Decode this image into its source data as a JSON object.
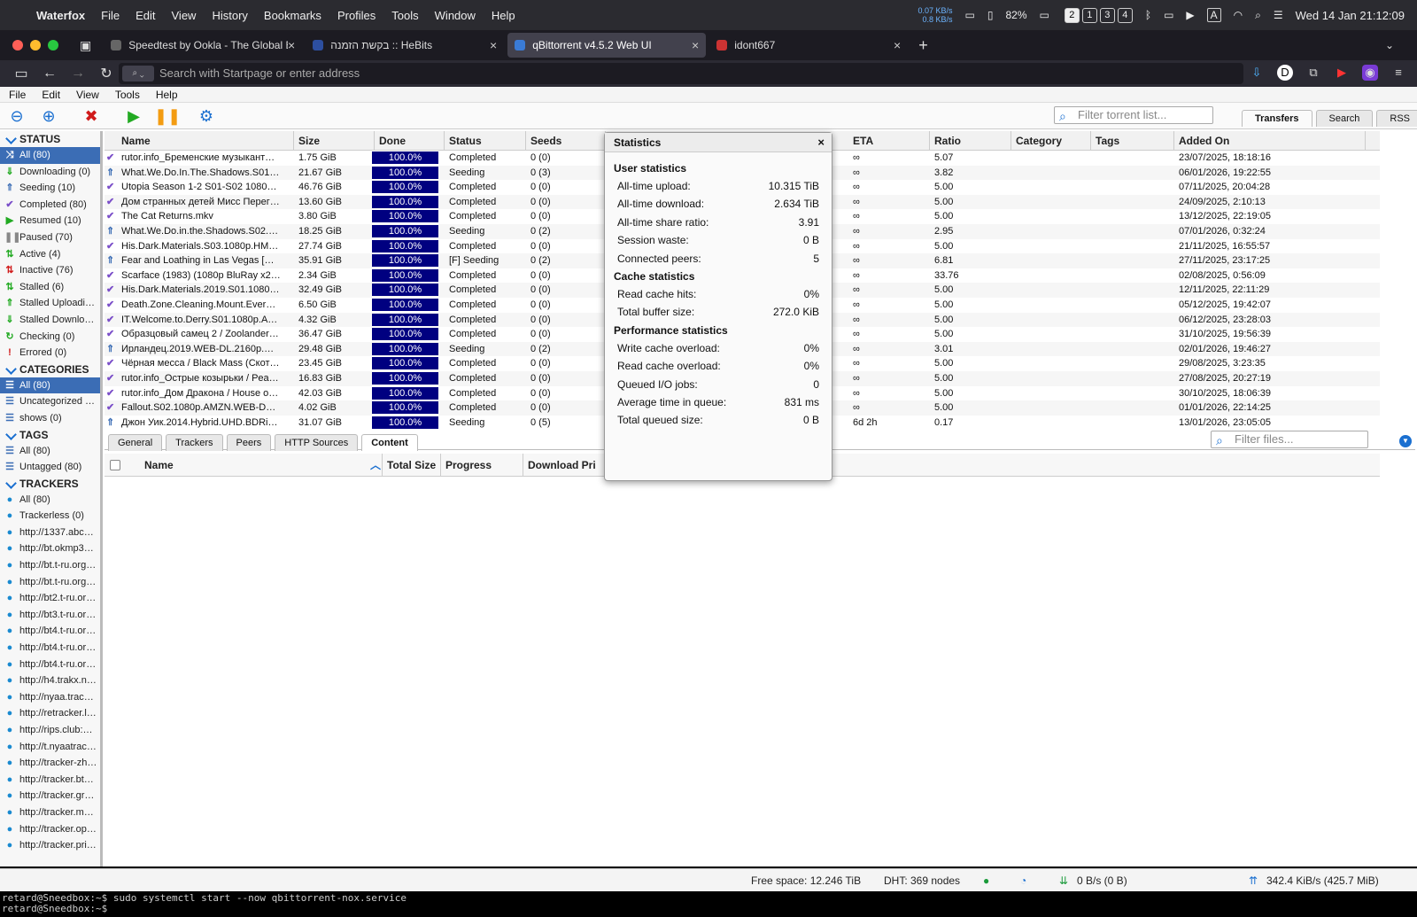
{
  "mac_menu": {
    "app": "Waterfox",
    "items": [
      "File",
      "Edit",
      "View",
      "History",
      "Bookmarks",
      "Profiles",
      "Tools",
      "Window",
      "Help"
    ],
    "speed_up": "0.07 KB/s",
    "speed_down": "0.8 KB/s",
    "battery": "82%",
    "spaces": [
      "2",
      "1",
      "3",
      "4"
    ],
    "input": "A",
    "clock": "Wed 14 Jan  21:12:09"
  },
  "tabs": [
    {
      "title": "Speedtest by Ookla - The Global B",
      "active": false
    },
    {
      "title": "בקשת הזמנה :: HeBits",
      "active": false
    },
    {
      "title": "qBittorrent v4.5.2 Web UI",
      "active": true
    },
    {
      "title": "idont667",
      "active": false
    }
  ],
  "url_placeholder": "Search with Startpage or enter address",
  "app_menu": [
    "File",
    "Edit",
    "View",
    "Tools",
    "Help"
  ],
  "toolbar": {
    "filter_placeholder": "Filter torrent list...",
    "right_tabs": [
      "Transfers",
      "Search",
      "RSS"
    ]
  },
  "sidebar": {
    "status_header": "STATUS",
    "status": [
      "All (80)",
      "Downloading (0)",
      "Seeding (10)",
      "Completed (80)",
      "Resumed (10)",
      "Paused (70)",
      "Active (4)",
      "Inactive (76)",
      "Stalled (6)",
      "Stalled Uploadi…",
      "Stalled Downlo…",
      "Checking (0)",
      "Errored (0)"
    ],
    "categories_header": "CATEGORIES",
    "categories": [
      "All (80)",
      "Uncategorized …",
      "shows (0)"
    ],
    "tags_header": "TAGS",
    "tags": [
      "All (80)",
      "Untagged (80)"
    ],
    "trackers_header": "TRACKERS",
    "trackers": [
      "All (80)",
      "Trackerless (0)",
      "http://1337.abc…",
      "http://bt.okmp3…",
      "http://bt.t-ru.org…",
      "http://bt.t-ru.org…",
      "http://bt2.t-ru.or…",
      "http://bt3.t-ru.or…",
      "http://bt4.t-ru.or…",
      "http://bt4.t-ru.or…",
      "http://bt4.t-ru.or…",
      "http://h4.trakx.n…",
      "http://nyaa.trac…",
      "http://retracker.l…",
      "http://rips.club:…",
      "http://t.nyaatrac…",
      "http://tracker-zh…",
      "http://tracker.bt…",
      "http://tracker.gr…",
      "http://tracker.m…",
      "http://tracker.op…",
      "http://tracker.pri…"
    ]
  },
  "columns": [
    "Name",
    "Size",
    "Done",
    "Status",
    "Seeds",
    "ETA",
    "Ratio",
    "Category",
    "Tags",
    "Added On"
  ],
  "torrents": [
    {
      "name": "rutor.info_Бременские музыкант…",
      "size": "1.75 GiB",
      "done": "100.0%",
      "status": "Completed",
      "seeds": "0 (0)",
      "eta": "∞",
      "ratio": "5.07",
      "added": "23/07/2025, 18:18:16",
      "icon": "check"
    },
    {
      "name": "What.We.Do.In.The.Shadows.S01…",
      "size": "21.67 GiB",
      "done": "100.0%",
      "status": "Seeding",
      "seeds": "0 (3)",
      "eta": "∞",
      "ratio": "3.82",
      "added": "06/01/2026, 19:22:55",
      "icon": "up"
    },
    {
      "name": "Utopia Season 1-2 S01-S02 1080…",
      "size": "46.76 GiB",
      "done": "100.0%",
      "status": "Completed",
      "seeds": "0 (0)",
      "eta": "∞",
      "ratio": "5.00",
      "added": "07/11/2025, 20:04:28",
      "icon": "check"
    },
    {
      "name": "Дом странных детей Мисс Перег…",
      "size": "13.60 GiB",
      "done": "100.0%",
      "status": "Completed",
      "seeds": "0 (0)",
      "eta": "∞",
      "ratio": "5.00",
      "added": "24/09/2025, 2:10:13",
      "icon": "check"
    },
    {
      "name": "The Cat Returns.mkv",
      "size": "3.80 GiB",
      "done": "100.0%",
      "status": "Completed",
      "seeds": "0 (0)",
      "eta": "∞",
      "ratio": "5.00",
      "added": "13/12/2025, 22:19:05",
      "icon": "check"
    },
    {
      "name": "What.We.Do.in.the.Shadows.S02.…",
      "size": "18.25 GiB",
      "done": "100.0%",
      "status": "Seeding",
      "seeds": "0 (2)",
      "eta": "∞",
      "ratio": "2.95",
      "added": "07/01/2026, 0:32:24",
      "icon": "up"
    },
    {
      "name": "His.Dark.Materials.S03.1080p.HM…",
      "size": "27.74 GiB",
      "done": "100.0%",
      "status": "Completed",
      "seeds": "0 (0)",
      "eta": "∞",
      "ratio": "5.00",
      "added": "21/11/2025, 16:55:57",
      "icon": "check"
    },
    {
      "name": "Fear and Loathing in Las Vegas […",
      "size": "35.91 GiB",
      "done": "100.0%",
      "status": "[F] Seeding",
      "seeds": "0 (2)",
      "eta": "∞",
      "ratio": "6.81",
      "added": "27/11/2025, 23:17:25",
      "icon": "up"
    },
    {
      "name": "Scarface (1983) (1080p BluRay x2…",
      "size": "2.34 GiB",
      "done": "100.0%",
      "status": "Completed",
      "seeds": "0 (0)",
      "eta": "∞",
      "ratio": "33.76",
      "added": "02/08/2025, 0:56:09",
      "icon": "check"
    },
    {
      "name": "His.Dark.Materials.2019.S01.1080…",
      "size": "32.49 GiB",
      "done": "100.0%",
      "status": "Completed",
      "seeds": "0 (0)",
      "eta": "∞",
      "ratio": "5.00",
      "added": "12/11/2025, 22:11:29",
      "icon": "check"
    },
    {
      "name": "Death.Zone.Cleaning.Mount.Ever…",
      "size": "6.50 GiB",
      "done": "100.0%",
      "status": "Completed",
      "seeds": "0 (0)",
      "eta": "∞",
      "ratio": "5.00",
      "added": "05/12/2025, 19:42:07",
      "icon": "check"
    },
    {
      "name": "IT.Welcome.to.Derry.S01.1080p.A…",
      "size": "4.32 GiB",
      "done": "100.0%",
      "status": "Completed",
      "seeds": "0 (0)",
      "eta": "∞",
      "ratio": "5.00",
      "added": "06/12/2025, 23:28:03",
      "icon": "check"
    },
    {
      "name": "Образцовый самец 2 / Zoolander…",
      "size": "36.47 GiB",
      "done": "100.0%",
      "status": "Completed",
      "seeds": "0 (0)",
      "eta": "∞",
      "ratio": "5.00",
      "added": "31/10/2025, 19:56:39",
      "icon": "check"
    },
    {
      "name": "Ирландец.2019.WEB-DL.2160p.…",
      "size": "29.48 GiB",
      "done": "100.0%",
      "status": "Seeding",
      "seeds": "0 (2)",
      "eta": "∞",
      "ratio": "3.01",
      "added": "02/01/2026, 19:46:27",
      "icon": "up"
    },
    {
      "name": "Чёрная месса / Black Mass (Скот…",
      "size": "23.45 GiB",
      "done": "100.0%",
      "status": "Completed",
      "seeds": "0 (0)",
      "eta": "∞",
      "ratio": "5.00",
      "added": "29/08/2025, 3:23:35",
      "icon": "check"
    },
    {
      "name": "rutor.info_Острые козырьки / Pea…",
      "size": "16.83 GiB",
      "done": "100.0%",
      "status": "Completed",
      "seeds": "0 (0)",
      "eta": "∞",
      "ratio": "5.00",
      "added": "27/08/2025, 20:27:19",
      "icon": "check"
    },
    {
      "name": "rutor.info_Дом Дракона / House o…",
      "size": "42.03 GiB",
      "done": "100.0%",
      "status": "Completed",
      "seeds": "0 (0)",
      "eta": "∞",
      "ratio": "5.00",
      "added": "30/10/2025, 18:06:39",
      "icon": "check"
    },
    {
      "name": "Fallout.S02.1080p.AMZN.WEB-D…",
      "size": "4.02 GiB",
      "done": "100.0%",
      "status": "Completed",
      "seeds": "0 (0)",
      "eta": "∞",
      "ratio": "5.00",
      "added": "01/01/2026, 22:14:25",
      "icon": "check"
    },
    {
      "name": "Джон Уик.2014.Hybrid.UHD.BDRi…",
      "size": "31.07 GiB",
      "done": "100.0%",
      "status": "Seeding",
      "seeds": "0 (5)",
      "eta": "6d 2h",
      "ratio": "0.17",
      "added": "13/01/2026, 23:05:05",
      "icon": "up"
    }
  ],
  "bottom_tabs": [
    "General",
    "Trackers",
    "Peers",
    "HTTP Sources",
    "Content"
  ],
  "files_filter_placeholder": "Filter files...",
  "content_columns": [
    "Name",
    "Total Size",
    "Progress",
    "Download Pri"
  ],
  "stats": {
    "title": "Statistics",
    "close": "×",
    "user_header": "User statistics",
    "user": [
      {
        "label": "All-time upload:",
        "value": "10.315 TiB"
      },
      {
        "label": "All-time download:",
        "value": "2.634 TiB"
      },
      {
        "label": "All-time share ratio:",
        "value": "3.91"
      },
      {
        "label": "Session waste:",
        "value": "0 B"
      },
      {
        "label": "Connected peers:",
        "value": "5"
      }
    ],
    "cache_header": "Cache statistics",
    "cache": [
      {
        "label": "Read cache hits:",
        "value": "0%"
      },
      {
        "label": "Total buffer size:",
        "value": "272.0 KiB"
      }
    ],
    "perf_header": "Performance statistics",
    "perf": [
      {
        "label": "Write cache overload:",
        "value": "0%"
      },
      {
        "label": "Read cache overload:",
        "value": "0%"
      },
      {
        "label": "Queued I/O jobs:",
        "value": "0"
      },
      {
        "label": "Average time in queue:",
        "value": "831 ms"
      },
      {
        "label": "Total queued size:",
        "value": "0 B"
      }
    ]
  },
  "statusbar": {
    "free_space": "Free space: 12.246 TiB",
    "dht": "DHT: 369 nodes",
    "down": "0 B/s (0 B)",
    "up": "342.4 KiB/s (425.7 MiB)"
  },
  "terminal": [
    "retard@Sneedbox:~$ sudo systemctl start --now qbittorrent-nox.service",
    "retard@Sneedbox:~$ "
  ]
}
